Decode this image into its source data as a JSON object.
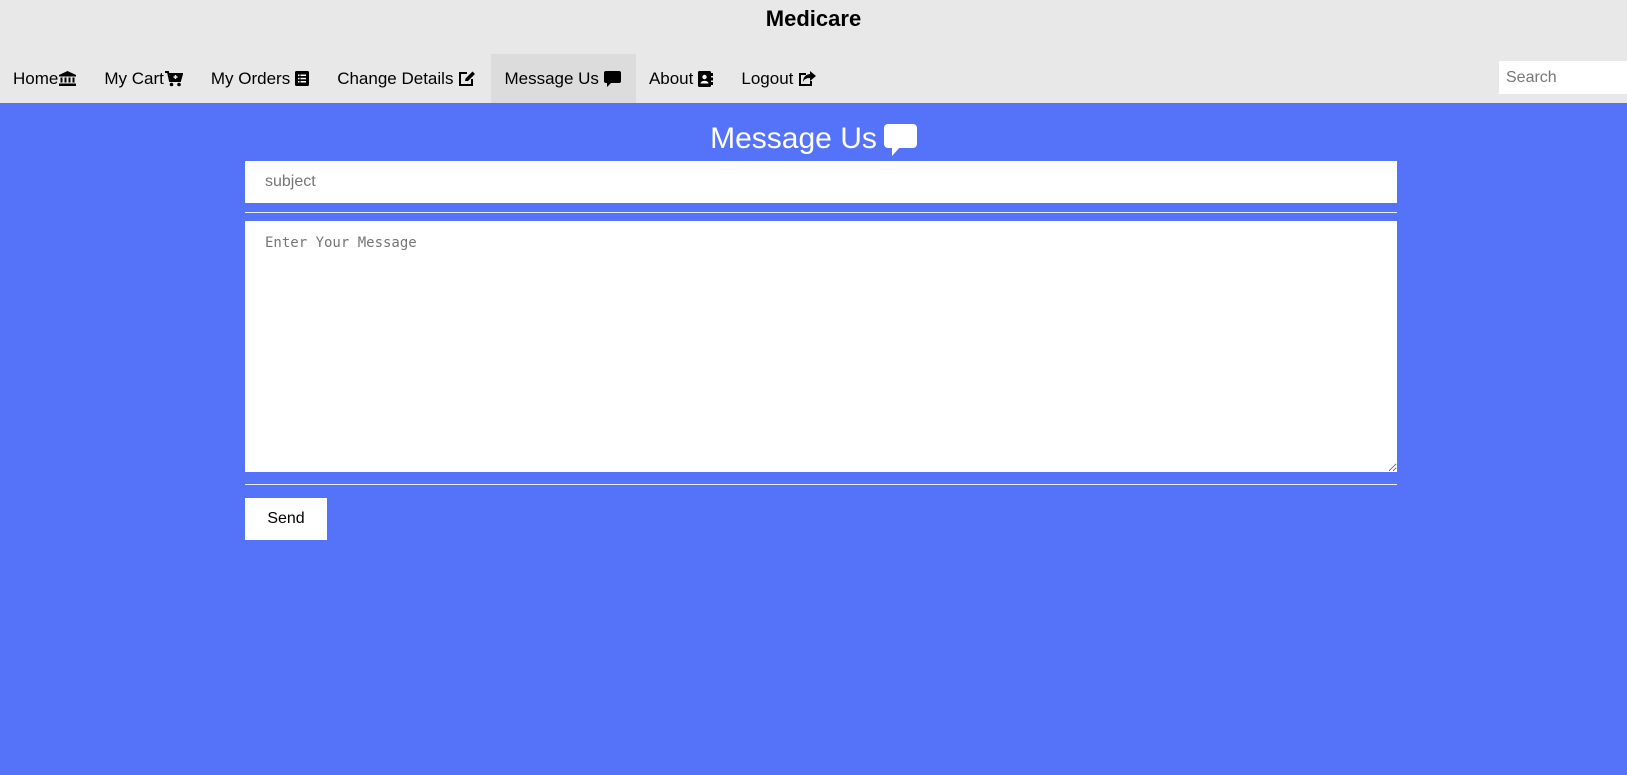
{
  "app": {
    "title": "Medicare"
  },
  "nav": {
    "items": [
      {
        "label": "Home",
        "icon": "bank-icon"
      },
      {
        "label": "My Cart",
        "icon": "cart-icon"
      },
      {
        "label": "My Orders",
        "icon": "list-icon"
      },
      {
        "label": "Change Details",
        "icon": "edit-icon"
      },
      {
        "label": "Message Us",
        "icon": "comment-icon",
        "active": true
      },
      {
        "label": "About",
        "icon": "address-book-icon"
      },
      {
        "label": "Logout",
        "icon": "share-icon"
      }
    ]
  },
  "search": {
    "placeholder": "Search"
  },
  "page": {
    "heading": "Message Us",
    "heading_icon": "comment-icon"
  },
  "form": {
    "subject_placeholder": "subject",
    "subject_value": "",
    "message_placeholder": "Enter Your Message",
    "message_value": "",
    "send_label": "Send"
  },
  "colors": {
    "background": "#5573f9",
    "header": "#e8e8e8",
    "active_tab": "#dcdcdc"
  }
}
